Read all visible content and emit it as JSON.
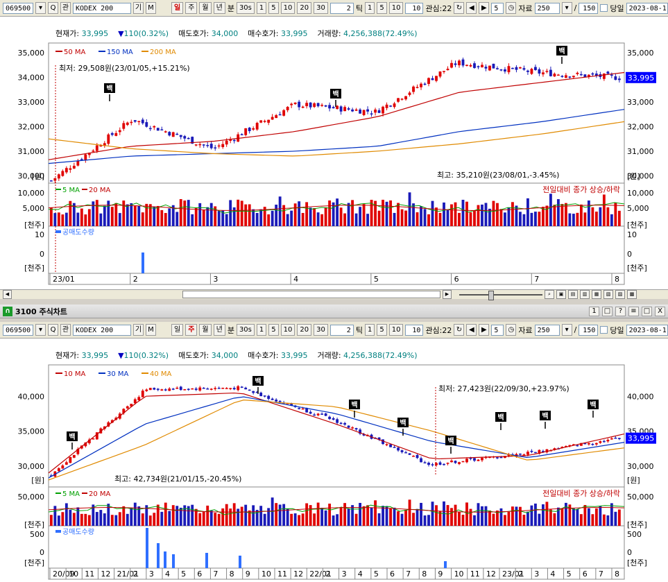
{
  "toolbar": {
    "code": "069500",
    "search_label": "Q",
    "name_tag": "관",
    "name": "KODEX 200",
    "name_btn1": "기",
    "name_btn2": "M",
    "period_btns": [
      "일",
      "주",
      "월",
      "년",
      "분",
      "30s"
    ],
    "active_top": "일",
    "active_bottom": "주",
    "minute_btns": [
      "1",
      "5",
      "10",
      "20",
      "30"
    ],
    "tick_value": "2",
    "tick_label": "틱",
    "tick_btns": [
      "1",
      "5",
      "10"
    ],
    "tick_input": "10",
    "interest_label": "관심:22",
    "spin_value": "5",
    "data_label": "자료",
    "data_count": "250",
    "slash": "/",
    "data_total": "150",
    "today_label": "당일",
    "date_value": "2023-08-1"
  },
  "colors": {
    "up": "#e00000",
    "down": "#1a1ab8",
    "ma_short": "#c00000",
    "ma_mid": "#0030c0",
    "ma_long": "#e08a00",
    "vol_ma5": "#00a000",
    "vol_ma20": "#c00000",
    "short_sell": "#2f6fff",
    "price_tag_bg": "#0000ff"
  },
  "top": {
    "info": {
      "cur_label": "현재가:",
      "cur_value": "33,995",
      "chg_arrow": "▼",
      "chg_value": "110(0.32%)",
      "ask_label": "매도호가:",
      "ask_value": "34,000",
      "bid_label": "매수호가:",
      "bid_value": "33,995",
      "vol_label": "거래량:",
      "vol_value": "4,256,388(72.49%)"
    },
    "legend": [
      "50 MA",
      "150 MA",
      "200 MA"
    ],
    "low_note": "최저: 29,508원(23/01/05,+15.21%)",
    "high_note": "최고: 35,210원(23/08/01,-3.45%)",
    "price_tag": "33,995",
    "price_axis": [
      "35,000",
      "34,000",
      "33,000",
      "32,000",
      "31,000",
      "30,000"
    ],
    "price_unit": "[원]",
    "vol_legend": [
      "5 MA",
      "20 MA"
    ],
    "vol_note": "전일대비 종가 상승/하락",
    "vol_axis": [
      "10,000",
      "5,000"
    ],
    "vol_unit": "[천주]",
    "short_legend": "공매도수량",
    "short_axis": [
      "10",
      "0"
    ],
    "short_unit": "[천주]",
    "x_labels": [
      "23/01",
      "2",
      "3",
      "4",
      "5",
      "6",
      "7",
      "8"
    ],
    "marker_label": "백"
  },
  "bottom_title": {
    "icon": "∩",
    "text": "3100 주식차트",
    "buttons": [
      "1",
      "□",
      "?",
      "≡",
      "□",
      "X"
    ]
  },
  "bottom": {
    "info": {
      "cur_label": "현재가:",
      "cur_value": "33,995",
      "chg_arrow": "▼",
      "chg_value": "110(0.32%)",
      "ask_label": "매도호가:",
      "ask_value": "34,000",
      "bid_label": "매수호가:",
      "bid_value": "33,995",
      "vol_label": "거래량:",
      "vol_value": "4,256,388(72.49%)"
    },
    "legend": [
      "10 MA",
      "30 MA",
      "40 MA"
    ],
    "low_note": "최저: 27,423원(22/09/30,+23.97%)",
    "high_note": "최고: 42,734원(21/01/15,-20.45%)",
    "price_tag": "33,995",
    "price_axis": [
      "40,000",
      "35,000",
      "30,000"
    ],
    "price_unit": "[원]",
    "vol_legend": [
      "5 MA",
      "20 MA"
    ],
    "vol_note": "전일대비 종가 상승/하락",
    "vol_axis": [
      "50,000"
    ],
    "vol_unit": "[천주]",
    "short_legend": "공매도수량",
    "short_axis": [
      "500",
      "0"
    ],
    "short_unit": "[천주]",
    "x_labels": [
      "20/09",
      "10",
      "11",
      "12",
      "21/01",
      "2",
      "3",
      "4",
      "5",
      "6",
      "7",
      "8",
      "9",
      "10",
      "11",
      "12",
      "22/01",
      "2",
      "3",
      "4",
      "5",
      "6",
      "7",
      "8",
      "9",
      "10",
      "11",
      "12",
      "23/01",
      "2",
      "3",
      "4",
      "5",
      "6",
      "7",
      "8"
    ],
    "marker_label": "백"
  },
  "chart_data": [
    {
      "type": "line",
      "title": "",
      "series": [
        {
          "name": "50 MA",
          "x": [
            "23/01",
            "2",
            "3",
            "4",
            "5",
            "6",
            "7",
            "8"
          ],
          "values": [
            30650,
            31200,
            31400,
            31800,
            32400,
            33400,
            33800,
            34200
          ]
        },
        {
          "name": "150 MA",
          "x": [
            "23/01",
            "2",
            "3",
            "4",
            "5",
            "6",
            "7",
            "8"
          ],
          "values": [
            30500,
            30800,
            30900,
            31000,
            31200,
            31800,
            32200,
            32700
          ]
        },
        {
          "name": "200 MA",
          "x": [
            "23/01",
            "2",
            "3",
            "4",
            "5",
            "6",
            "7",
            "8"
          ],
          "values": [
            31500,
            31100,
            30900,
            30800,
            31000,
            31300,
            31700,
            32200
          ]
        }
      ],
      "close": {
        "x": [
          "23/01",
          "2",
          "3",
          "4",
          "5",
          "6",
          "7",
          "8"
        ],
        "values": [
          29800,
          32300,
          31100,
          32900,
          32600,
          34600,
          34200,
          33995
        ]
      },
      "low": {
        "value": 29508,
        "date": "23/01/05"
      },
      "high": {
        "value": 35210,
        "date": "23/08/01"
      },
      "ylim": [
        29700,
        35400
      ]
    },
    {
      "type": "line",
      "title": "",
      "series": [
        {
          "name": "10 MA",
          "x": [
            "20/09",
            "21/01",
            "21/07",
            "22/01",
            "22/07",
            "23/01",
            "23/08"
          ],
          "values": [
            29000,
            40000,
            40500,
            36000,
            31000,
            31500,
            34600
          ]
        },
        {
          "name": "30 MA",
          "x": [
            "20/09",
            "21/01",
            "21/07",
            "22/01",
            "22/07",
            "23/01",
            "23/08"
          ],
          "values": [
            28300,
            36000,
            40000,
            37500,
            33500,
            31200,
            33400
          ]
        },
        {
          "name": "40 MA",
          "x": [
            "20/09",
            "21/01",
            "21/07",
            "22/01",
            "22/07",
            "23/01",
            "23/08"
          ],
          "values": [
            28000,
            33000,
            39500,
            38500,
            35000,
            30800,
            32600
          ]
        }
      ],
      "close": {
        "x": [
          "20/09",
          "21/01",
          "21/07",
          "22/01",
          "22/07",
          "23/01",
          "23/08"
        ],
        "values": [
          28800,
          41000,
          41200,
          36500,
          30200,
          31800,
          33995
        ]
      },
      "low": {
        "value": 27423,
        "date": "22/09/30"
      },
      "high": {
        "value": 42734,
        "date": "21/01/15"
      },
      "ylim": [
        27000,
        44500
      ]
    }
  ]
}
